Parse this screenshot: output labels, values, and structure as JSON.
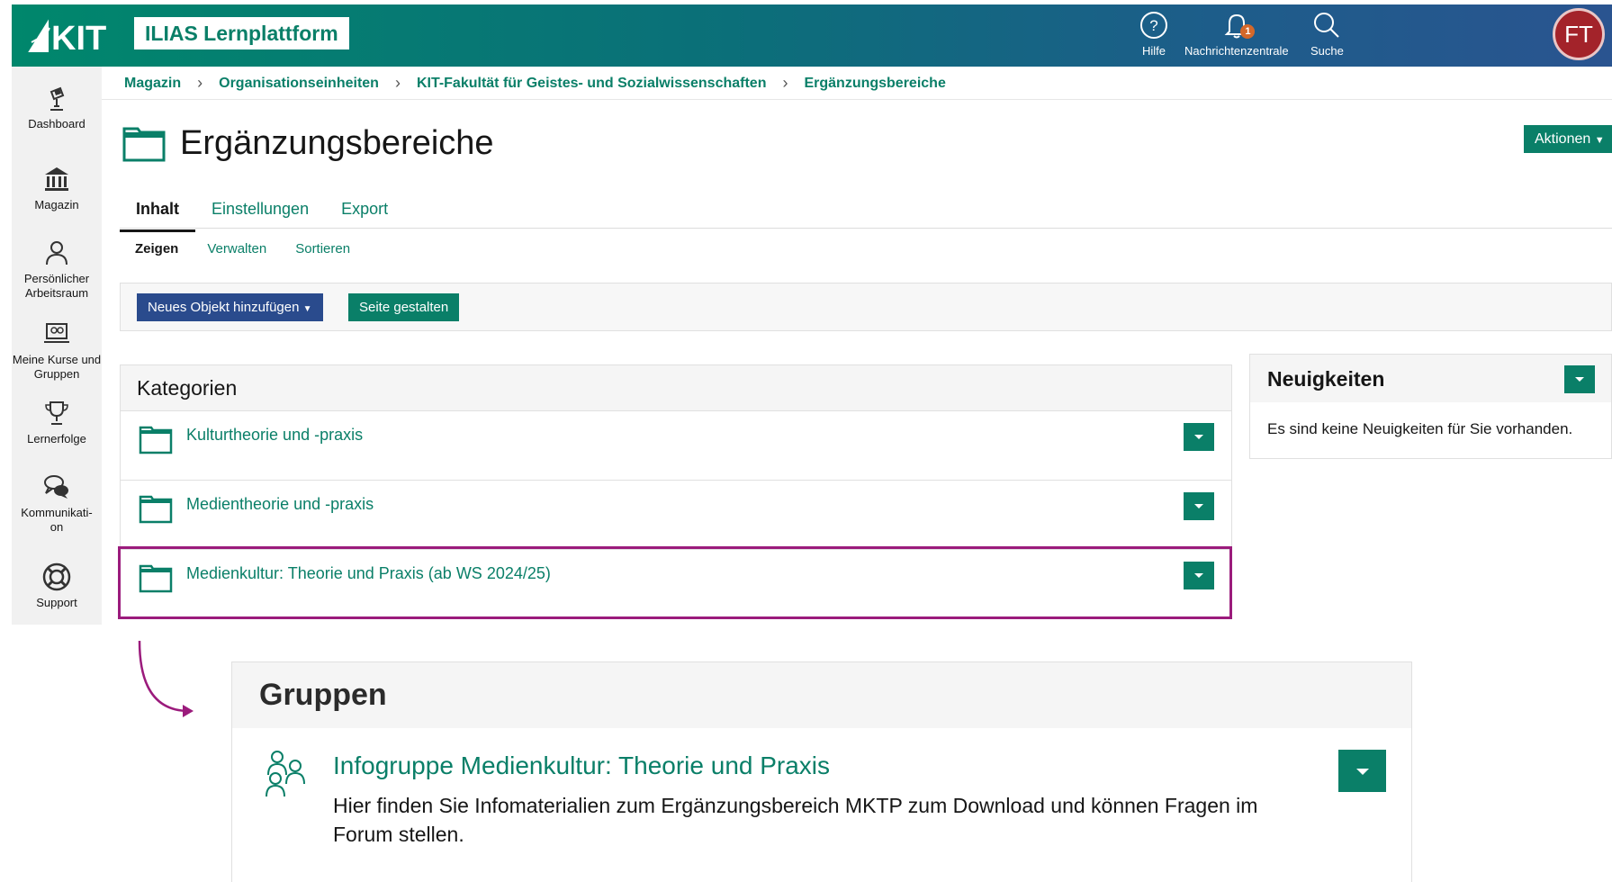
{
  "header": {
    "logo_text": "KIT",
    "platform_name": "ILIAS Lernplattform",
    "help_label": "Hilfe",
    "notifications_label": "Nachrichtenzentrale",
    "notifications_count": "1",
    "search_label": "Suche",
    "avatar_initials": "FT"
  },
  "sidebar": {
    "items": [
      {
        "label": "Dashboard",
        "icon": "dashboard-icon"
      },
      {
        "label": "Magazin",
        "icon": "repository-icon"
      },
      {
        "label": "Persönlicher Arbeitsraum",
        "icon": "person-icon"
      },
      {
        "label": "Meine Kurse und Gruppen",
        "icon": "courses-icon"
      },
      {
        "label": "Lernerfolge",
        "icon": "trophy-icon"
      },
      {
        "label": "Kommunikati-on",
        "icon": "communication-icon"
      },
      {
        "label": "Support",
        "icon": "lifebuoy-icon"
      }
    ]
  },
  "breadcrumb": [
    "Magazin",
    "Organisationseinheiten",
    "KIT-Fakultät für Geistes- und Sozialwissenschaften",
    "Ergänzungsbereiche"
  ],
  "page": {
    "title": "Ergänzungsbereiche",
    "actions_label": "Aktionen"
  },
  "tabs": [
    "Inhalt",
    "Einstellungen",
    "Export"
  ],
  "subtabs": [
    "Zeigen",
    "Verwalten",
    "Sortieren"
  ],
  "toolbar": {
    "add_object_label": "Neues Objekt hinzufügen",
    "design_page_label": "Seite gestalten"
  },
  "categories": {
    "heading": "Kategorien",
    "items": [
      "Kulturtheorie und -praxis",
      "Medientheorie und -praxis",
      "Medienkultur: Theorie und Praxis (ab WS 2024/25)"
    ]
  },
  "news": {
    "heading": "Neuigkeiten",
    "empty_text": "Es sind keine Neuigkeiten für Sie vorhanden."
  },
  "groups": {
    "heading": "Gruppen",
    "item_title": "Infogruppe Medienkultur: Theorie und Praxis",
    "item_description": "Hier finden Sie Infomaterialien zum Ergänzungsbereich MKTP zum Download und können Fragen im Forum stellen."
  },
  "colors": {
    "accent": "#0a7f68",
    "primary_button": "#2a4b8d",
    "highlight": "#9b1b7c"
  }
}
